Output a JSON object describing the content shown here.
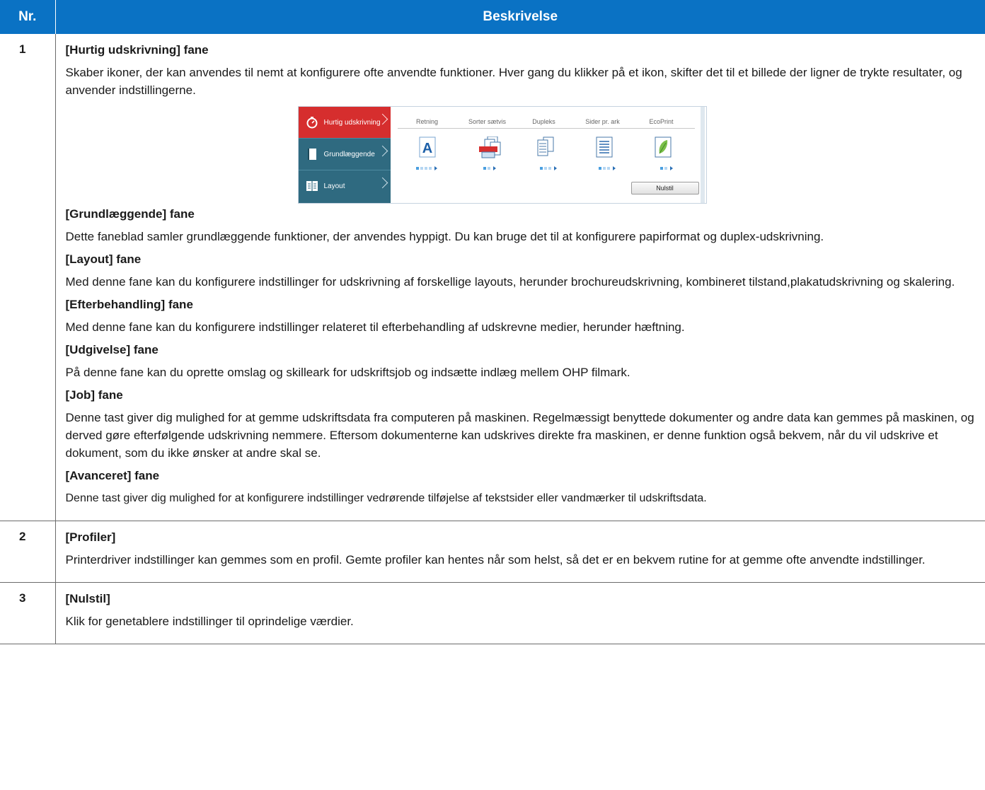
{
  "table": {
    "header": {
      "col_num": "Nr.",
      "col_desc": "Beskrivelse"
    },
    "rows": [
      {
        "num": "1",
        "sections": [
          {
            "title": "[Hurtig udskrivning] fane",
            "body": "Skaber ikoner, der kan anvendes til nemt at konfigurere ofte anvendte funktioner. Hver gang du klikker på et ikon, skifter det til et billede der ligner de trykte resultater, og anvender indstillingerne."
          },
          {
            "title": "[Grundlæggende] fane",
            "body": "Dette faneblad samler grundlæggende funktioner, der anvendes hyppigt. Du kan bruge det til at konfigurere papirformat og duplex-udskrivning."
          },
          {
            "title": "[Layout] fane",
            "body": "Med denne fane kan du konfigurere indstillinger for udskrivning af forskellige layouts, herunder brochureudskrivning, kombineret tilstand,plakatudskrivning og skalering."
          },
          {
            "title": "[Efterbehandling] fane",
            "body": "Med denne fane kan du konfigurere indstillinger relateret til efterbehandling af udskrevne medier, herunder hæftning."
          },
          {
            "title": "[Udgivelse] fane",
            "body": "På denne fane kan du oprette omslag og skilleark for udskriftsjob og indsætte indlæg mellem OHP filmark."
          },
          {
            "title": "[Job] fane",
            "body": "Denne tast giver dig mulighed for at gemme udskriftsdata fra computeren på maskinen. Regelmæssigt benyttede dokumenter og andre data kan gemmes på maskinen, og derved gøre efterfølgende udskrivning nemmere. Eftersom dokumenterne kan udskrives direkte fra maskinen, er denne funktion også bekvem, når du vil udskrive et dokument, som du ikke ønsker at andre skal se."
          },
          {
            "title": "[Avanceret] fane",
            "body": "Denne tast giver dig mulighed for at konfigurere indstillinger vedrørende tilføjelse af tekstsider eller vandmærker til udskriftsdata."
          }
        ]
      },
      {
        "num": "2",
        "sections": [
          {
            "title": "[Profiler]",
            "body": "Printerdriver indstillinger kan gemmes som en profil. Gemte profiler kan hentes når som helst, så det er en bekvem rutine for at gemme ofte anvendte indstillinger."
          }
        ]
      },
      {
        "num": "3",
        "sections": [
          {
            "title": "[Nulstil]",
            "body": "Klik for genetablere indstillinger til oprindelige værdier."
          }
        ]
      }
    ]
  },
  "screenshot": {
    "sidebar": [
      {
        "label": "Hurtig udskrivning",
        "icon": "stopwatch-icon",
        "active": true
      },
      {
        "label": "Grundlæggende",
        "icon": "page-icon",
        "active": false
      },
      {
        "label": "Layout",
        "icon": "layout-icon",
        "active": false
      }
    ],
    "functions": [
      {
        "label": "Retning",
        "icon": "orientation-a-icon",
        "steps": 4,
        "selected": 1
      },
      {
        "label": "Sorter sætvis",
        "icon": "collate-icon",
        "steps": 2,
        "selected": 1
      },
      {
        "label": "Dupleks",
        "icon": "duplex-icon",
        "steps": 3,
        "selected": 1
      },
      {
        "label": "Sider pr. ark",
        "icon": "pages-per-sheet-icon",
        "steps": 3,
        "selected": 1
      },
      {
        "label": "EcoPrint",
        "icon": "leaf-icon",
        "steps": 2,
        "selected": 1
      }
    ],
    "reset_label": "Nulstil",
    "colors": {
      "header": "#0a72c4",
      "sidebar": "#2f6a80",
      "active_tab": "#d62e2e",
      "accent": "#4a9fe0"
    }
  }
}
